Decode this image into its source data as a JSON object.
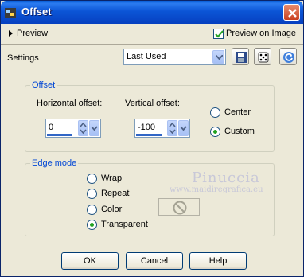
{
  "window": {
    "title": "Offset"
  },
  "preview": {
    "label": "Preview",
    "preview_on_image_label": "Preview on Image",
    "preview_on_image_checked": true
  },
  "settings": {
    "label": "Settings",
    "selected": "Last Used",
    "icons": [
      "save-icon",
      "randomize-icon",
      "reset-icon"
    ]
  },
  "offset": {
    "legend": "Offset",
    "horizontal_label": "Horizontal offset:",
    "horizontal_value": "0",
    "vertical_label": "Vertical offset:",
    "vertical_value": "-100",
    "options": [
      "Center",
      "Custom"
    ],
    "selected": "Custom"
  },
  "edge_mode": {
    "legend": "Edge mode",
    "options": [
      "Wrap",
      "Repeat",
      "Color",
      "Transparent"
    ],
    "selected": "Transparent"
  },
  "watermark": {
    "line1": "Pinuccia",
    "line2": "www.maidiregrafica.eu"
  },
  "buttons": {
    "ok": "OK",
    "cancel": "Cancel",
    "help": "Help"
  },
  "colors": {
    "titlebar": "#0b55d6",
    "legend_text": "#0046d5",
    "face": "#ece9d8",
    "radio_dot": "#21a121"
  }
}
